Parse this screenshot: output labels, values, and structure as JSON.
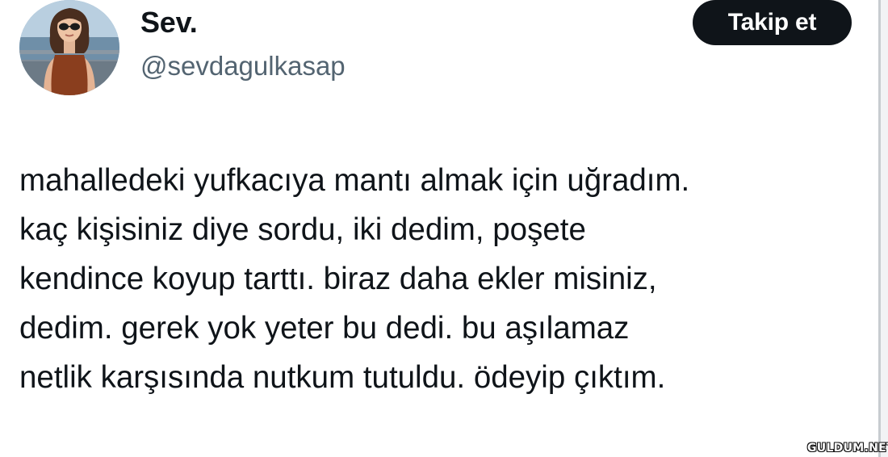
{
  "author": {
    "display_name": "Sev.",
    "handle": "@sevdagulkasap",
    "avatar": "profile-photo"
  },
  "follow_button": {
    "label": "Takip et"
  },
  "tweet": {
    "lines": [
      "mahalledeki yufkacıya mantı almak için uğradım.",
      "kaç kişisiniz diye sordu, iki dedim, poşete",
      "kendince koyup tarttı. biraz daha ekler misiniz,",
      "dedim. gerek yok yeter bu dedi. bu aşılamaz",
      "netlik karşısında nutkum tutuldu. ödeyip çıktım."
    ]
  },
  "watermark": {
    "text": "GULDUM.NET"
  },
  "colors": {
    "text_primary": "#0f1419",
    "text_secondary": "#536471",
    "button_bg": "#0f1419",
    "button_text": "#ffffff",
    "background": "#ffffff"
  }
}
